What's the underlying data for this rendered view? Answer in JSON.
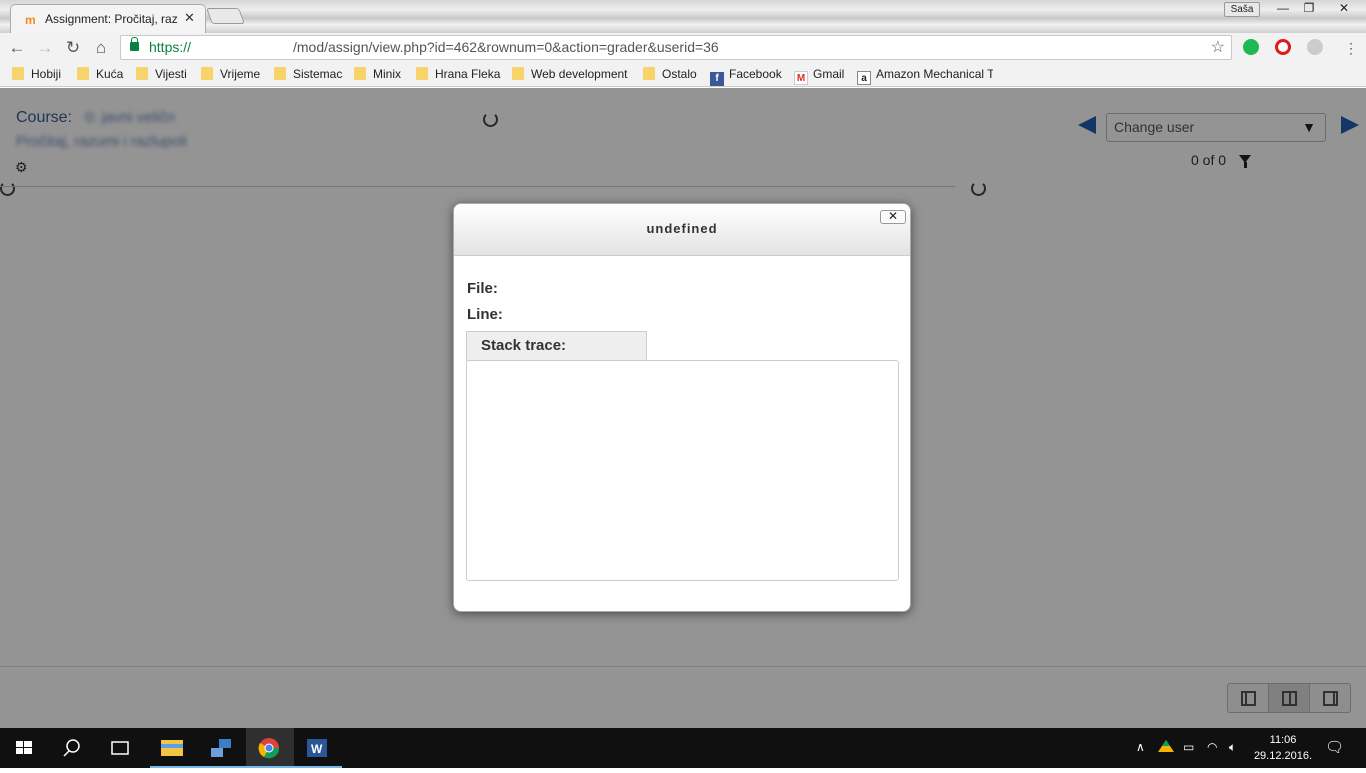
{
  "browser": {
    "tab_title": "Assignment: Pročitaj, raz",
    "tab_favicon": "m",
    "profile_name": "Saša",
    "url_scheme": "https://",
    "url_path": "/mod/assign/view.php?id=462&rownum=0&action=grader&userid=36"
  },
  "bookmarks": [
    {
      "label": "Hobiji",
      "icon": "folder-icon"
    },
    {
      "label": "Kuća",
      "icon": "folder-icon"
    },
    {
      "label": "Vijesti",
      "icon": "folder-icon"
    },
    {
      "label": "Vrijeme",
      "icon": "folder-icon"
    },
    {
      "label": "Sistemac",
      "icon": "folder-icon"
    },
    {
      "label": "Minix",
      "icon": "folder-icon"
    },
    {
      "label": "Hrana Fleka",
      "icon": "folder-icon"
    },
    {
      "label": "Web development",
      "icon": "folder-icon"
    },
    {
      "label": "Ostalo",
      "icon": "folder-icon"
    },
    {
      "label": "Facebook",
      "icon": "facebook-icon"
    },
    {
      "label": "Gmail",
      "icon": "gmail-icon"
    },
    {
      "label": "Amazon Mechanical T",
      "icon": "amazon-icon"
    }
  ],
  "page": {
    "course_label": "Course:",
    "course_name_blurred": "0: javni veličn",
    "assignment_blurred": "Pročitaj, razumi i razlupoli",
    "change_user_placeholder": "Change user",
    "user_count": "0 of 0"
  },
  "dialog": {
    "title": "undefined",
    "close_label": "✕",
    "file_label": "File:",
    "line_label": "Line:",
    "stack_trace_label": "Stack trace:"
  },
  "taskbar": {
    "time": "11:06",
    "date": "29.12.2016."
  },
  "colors": {
    "accent": "#1f5fb0",
    "overlay": "#000000",
    "secure": "#0b8043"
  }
}
